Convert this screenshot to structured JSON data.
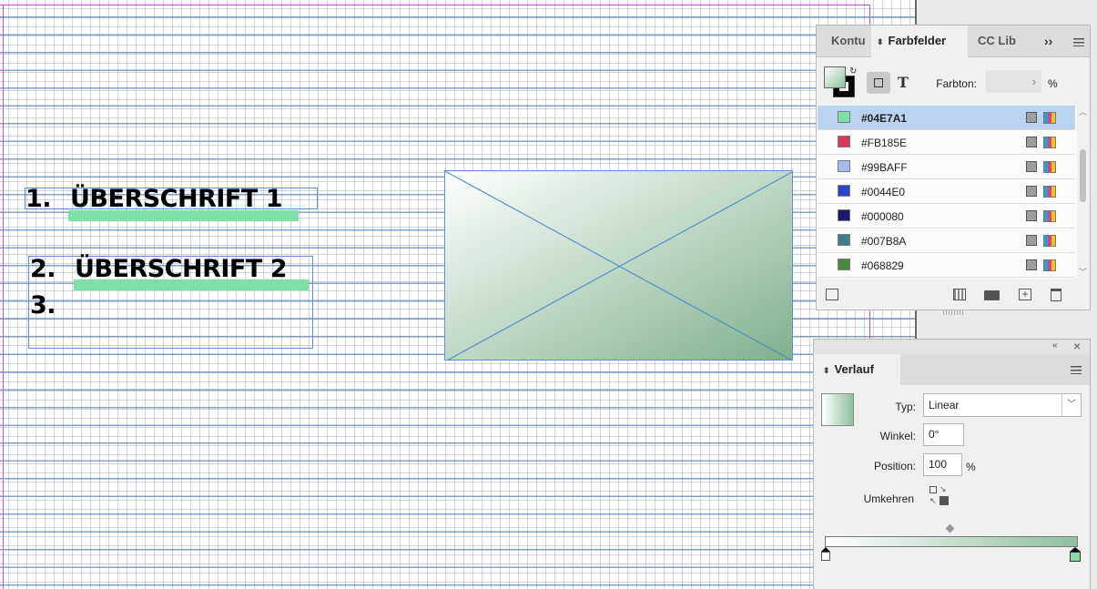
{
  "canvas": {
    "headings": [
      {
        "number": "1.",
        "text": "ÜBERSCHRIFT 1"
      },
      {
        "number": "2.",
        "text": "ÜBERSCHRIFT 2"
      },
      {
        "number": "3.",
        "text": ""
      }
    ],
    "highlight_color": "#7ee0a8",
    "image_gradient": {
      "start": "#ffffff",
      "end": "#7fb08c"
    }
  },
  "swatches_panel": {
    "tabs": [
      {
        "label": "Kontu"
      },
      {
        "label": "Farbfelder"
      },
      {
        "label": "CC Lib"
      }
    ],
    "overflow_label": "››",
    "tint_label": "Farbton:",
    "tint_value": "",
    "tint_unit": "%",
    "swatches": [
      {
        "name": "#04E7A1",
        "color": "#7ee0a8",
        "selected": true
      },
      {
        "name": "#FB185E",
        "color": "#d63a57",
        "selected": false
      },
      {
        "name": "#99BAFF",
        "color": "#a4b8f2",
        "selected": false
      },
      {
        "name": "#0044E0",
        "color": "#2e45c8",
        "selected": false
      },
      {
        "name": "#000080",
        "color": "#1a1a6e",
        "selected": false
      },
      {
        "name": "#007B8A",
        "color": "#3f7a8a",
        "selected": false
      },
      {
        "name": "#068829",
        "color": "#4a8a3e",
        "selected": false
      }
    ],
    "icons": [
      "swap-fill-stroke-icon",
      "container-icon",
      "text-icon",
      "new-swatch-group-icon",
      "folder-icon",
      "new-swatch-icon",
      "trash-icon"
    ]
  },
  "gradient_panel": {
    "tab_label": "Verlauf",
    "type_label": "Typ:",
    "type_value": "Linear",
    "angle_label": "Winkel:",
    "angle_value": "0°",
    "position_label": "Position:",
    "position_value": "100",
    "position_unit": "%",
    "reverse_label": "Umkehren",
    "gradient": {
      "start": "#ffffff",
      "end": "#8fc0a0"
    },
    "icons": [
      "collapse-icon",
      "close-icon",
      "menu-icon",
      "reverse-icon",
      "midpoint-icon",
      "stop-icon"
    ]
  }
}
